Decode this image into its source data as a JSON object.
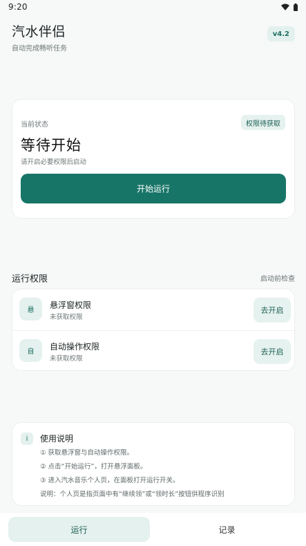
{
  "status_bar": {
    "time": "9:20",
    "icons": [
      "wifi-icon",
      "battery-icon"
    ]
  },
  "header": {
    "title": "汽水伴侣",
    "subtitle": "自动完成畅听任务",
    "version": "v4.2"
  },
  "status_card": {
    "label": "当前状态",
    "badge": "权限待获取",
    "title": "等待开始",
    "hint": "请开启必要权限后启动",
    "button": "开始运行"
  },
  "permissions": {
    "title": "运行权限",
    "note": "启动前检查",
    "items": [
      {
        "icon_text": "悬",
        "name": "悬浮窗权限",
        "state": "未获取权限",
        "action": "去开启"
      },
      {
        "icon_text": "自",
        "name": "自动操作权限",
        "state": "未获取权限",
        "action": "去开启"
      }
    ]
  },
  "help": {
    "icon_text": "i",
    "title": "使用说明",
    "lines": [
      "① 获取悬浮窗与自动操作权限。",
      "② 点击“开始运行”，打开悬浮面板。",
      "③ 进入汽水音乐个人页，在面板打开运行开关。",
      "说明：个人页是指页面中有“继续领”或“领时长”按钮供程序识别"
    ]
  },
  "nav": {
    "items": [
      {
        "label": "运行",
        "active": true
      },
      {
        "label": "记录",
        "active": false
      }
    ]
  },
  "colors": {
    "accent": "#177567",
    "accent_soft": "#e4f1ee",
    "background": "#f7f8f8"
  }
}
